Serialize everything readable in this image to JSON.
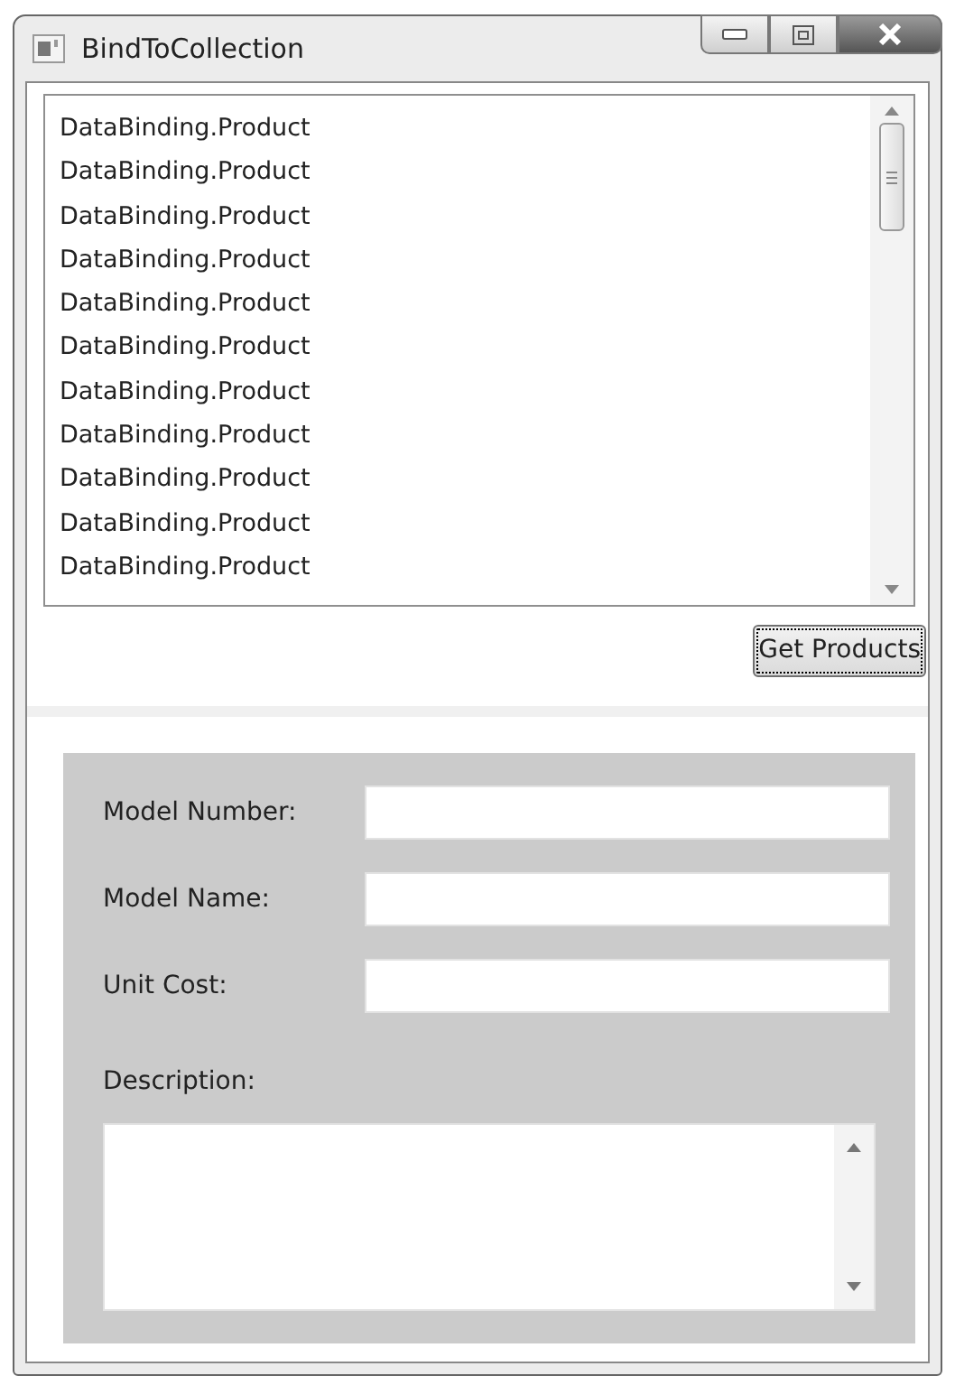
{
  "window": {
    "title": "BindToCollection"
  },
  "product_list": {
    "items": [
      "DataBinding.Product",
      "DataBinding.Product",
      "DataBinding.Product",
      "DataBinding.Product",
      "DataBinding.Product",
      "DataBinding.Product",
      "DataBinding.Product",
      "DataBinding.Product",
      "DataBinding.Product",
      "DataBinding.Product",
      "DataBinding.Product"
    ]
  },
  "get_products_button": {
    "label": "Get Products"
  },
  "details": {
    "fields": [
      {
        "label": "Model Number:"
      },
      {
        "label": "Model Name:"
      },
      {
        "label": "Unit Cost:"
      }
    ],
    "description": {
      "label": "Description:"
    }
  }
}
